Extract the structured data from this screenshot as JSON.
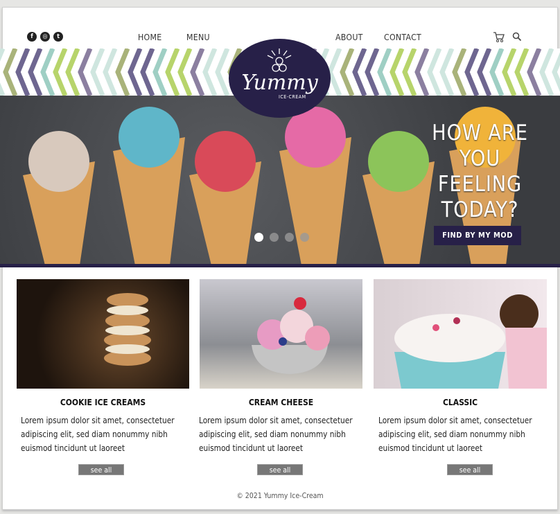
{
  "nav": {
    "social": [
      {
        "icon": "facebook-icon",
        "glyph": "f"
      },
      {
        "icon": "instagram-icon",
        "glyph": "◎"
      },
      {
        "icon": "twitter-icon",
        "glyph": "t"
      }
    ],
    "links": [
      "HOME",
      "MENU",
      "ABOUT",
      "CONTACT"
    ],
    "cart_icon": "cart-icon",
    "search_icon": "search-icon"
  },
  "logo": {
    "word": "Yummy",
    "sub": "ICE-CREAM"
  },
  "hero": {
    "headline": [
      "HOW ARE",
      "YOU",
      "FEELING",
      "TODAY?"
    ],
    "cta": "FIND BY MY MOD",
    "slides": 4,
    "active_slide": 1
  },
  "colors": {
    "brand": "#272048",
    "chevrons": [
      "#cfe6df",
      "#8b7fa0",
      "#b7d46b",
      "#9fcfc4",
      "#6e6690",
      "#a9b37a"
    ]
  },
  "cards": [
    {
      "title": "COOKIE ICE CREAMS",
      "text": "Lorem ipsum dolor sit amet, consectetuer adipiscing elit, sed diam nonummy nibh euismod tincidunt ut laoreet",
      "button": "see all"
    },
    {
      "title": "CREAM CHEESE",
      "text": "Lorem ipsum dolor sit amet, consectetuer adipiscing elit, sed diam nonummy nibh euismod tincidunt ut laoreet",
      "button": "see all"
    },
    {
      "title": "CLASSIC",
      "text": "Lorem ipsum dolor sit amet, consectetuer adipiscing elit, sed diam nonummy nibh euismod tincidunt ut laoreet",
      "button": "see all"
    }
  ],
  "footer": "© 2021 Yummy Ice-Cream"
}
